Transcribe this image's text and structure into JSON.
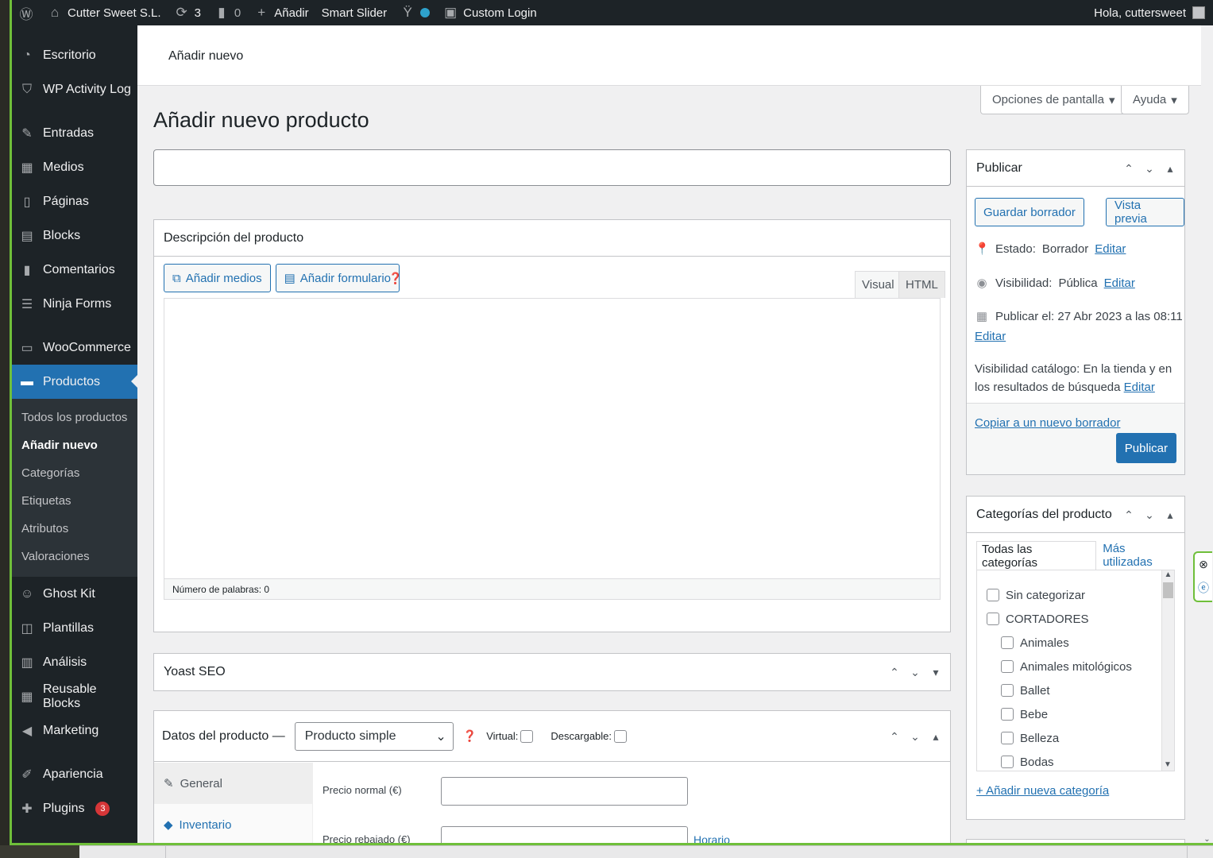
{
  "adminbar": {
    "site_name": "Cutter Sweet S.L.",
    "updates_count": "3",
    "comments_count": "0",
    "add_new": "Añadir",
    "smart_slider": "Smart Slider",
    "custom_login": "Custom Login",
    "greeting": "Hola, cuttersweet"
  },
  "sidebar": {
    "items": [
      {
        "label": "Escritorio",
        "icon": "dashboard-icon"
      },
      {
        "label": "WP Activity Log",
        "icon": "shield-icon"
      },
      {
        "label": "Entradas",
        "icon": "pin-icon"
      },
      {
        "label": "Medios",
        "icon": "media-icon"
      },
      {
        "label": "Páginas",
        "icon": "page-icon"
      },
      {
        "label": "Blocks",
        "icon": "blocks-icon"
      },
      {
        "label": "Comentarios",
        "icon": "comment-icon"
      },
      {
        "label": "Ninja Forms",
        "icon": "forms-icon"
      },
      {
        "label": "WooCommerce",
        "icon": "woo-icon"
      },
      {
        "label": "Productos",
        "icon": "archive-icon"
      },
      {
        "label": "Ghost Kit",
        "icon": "ghost-icon"
      },
      {
        "label": "Plantillas",
        "icon": "templates-icon"
      },
      {
        "label": "Análisis",
        "icon": "chart-icon"
      },
      {
        "label": "Reusable Blocks",
        "icon": "reusable-icon"
      },
      {
        "label": "Marketing",
        "icon": "megaphone-icon"
      },
      {
        "label": "Apariencia",
        "icon": "brush-icon"
      },
      {
        "label": "Plugins",
        "icon": "plugin-icon",
        "badge": "3"
      }
    ],
    "submenu": [
      "Todos los productos",
      "Añadir nuevo",
      "Categorías",
      "Etiquetas",
      "Atributos",
      "Valoraciones"
    ]
  },
  "header": {
    "breadcrumb": "Añadir nuevo",
    "screen_options": "Opciones de pantalla",
    "help": "Ayuda",
    "page_title": "Añadir nuevo producto"
  },
  "description_box": {
    "title": "Descripción del producto",
    "add_media": "Añadir medios",
    "add_form": "Añadir formulario",
    "tab_visual": "Visual",
    "tab_html": "HTML",
    "word_count": "Número de palabras: 0"
  },
  "yoast": {
    "title": "Yoast SEO"
  },
  "product_data": {
    "title": "Datos del producto —",
    "type_selected": "Producto simple",
    "virtual_label": "Virtual:",
    "downloadable_label": "Descargable:",
    "tabs": [
      "General",
      "Inventario"
    ],
    "regular_price_label": "Precio normal (€)",
    "sale_price_label": "Precio rebajado (€)",
    "schedule_link": "Horario"
  },
  "publish": {
    "title": "Publicar",
    "save_draft": "Guardar borrador",
    "preview": "Vista previa",
    "status_label": "Estado:",
    "status_value": "Borrador",
    "visibility_label": "Visibilidad:",
    "visibility_value": "Pública",
    "publish_on": "Publicar el: 27 Abr 2023 a las 08:11",
    "catalog_label": "Visibilidad catálogo:",
    "catalog_value": "En la tienda y en los resultados de búsqueda",
    "edit": "Editar",
    "copy_draft": "Copiar a un nuevo borrador",
    "publish_button": "Publicar"
  },
  "categories": {
    "title": "Categorías del producto",
    "tab_all": "Todas las categorías",
    "tab_most_used": "Más utilizadas",
    "items": [
      {
        "label": "Sin categorizar",
        "level": 0
      },
      {
        "label": "CORTADORES",
        "level": 0
      },
      {
        "label": "Animales",
        "level": 1
      },
      {
        "label": "Animales mitológicos",
        "level": 1
      },
      {
        "label": "Ballet",
        "level": 1
      },
      {
        "label": "Bebe",
        "level": 1
      },
      {
        "label": "Belleza",
        "level": 1
      },
      {
        "label": "Bodas",
        "level": 1
      }
    ],
    "add_new": "+ Añadir nueva categoría"
  },
  "colors": {
    "accent": "#2271b1",
    "sidebar": "#1d2327",
    "border_green": "#6fbf3a"
  }
}
